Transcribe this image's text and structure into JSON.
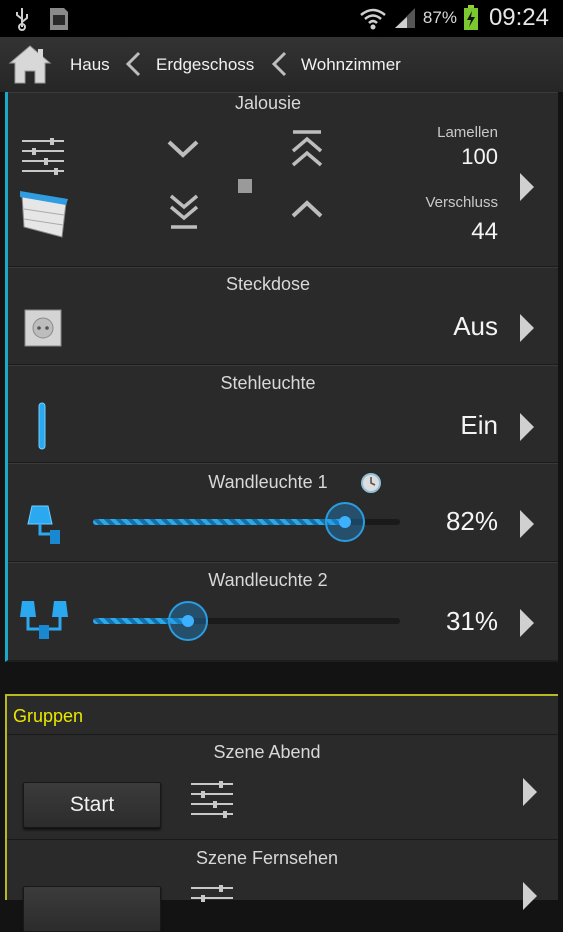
{
  "status": {
    "battery_pct": "87%",
    "time": "09:24"
  },
  "breadcrumb": {
    "items": [
      "Haus",
      "Erdgeschoss",
      "Wohnzimmer"
    ]
  },
  "devices": {
    "jalousie": {
      "title": "Jalousie",
      "lamellen_label": "Lamellen",
      "lamellen_value": "100",
      "verschluss_label": "Verschluss",
      "verschluss_value": "44"
    },
    "steckdose": {
      "title": "Steckdose",
      "value": "Aus"
    },
    "stehleuchte": {
      "title": "Stehleuchte",
      "value": "Ein"
    },
    "wandleuchte1": {
      "title": "Wandleuchte 1",
      "value": "82%",
      "level": 82
    },
    "wandleuchte2": {
      "title": "Wandleuchte 2",
      "value": "31%",
      "level": 31
    }
  },
  "groups": {
    "title": "Gruppen",
    "scenes": [
      {
        "title": "Szene Abend",
        "button": "Start"
      },
      {
        "title": "Szene Fernsehen",
        "button": ""
      }
    ]
  },
  "colors": {
    "accent_blue": "#1aa8c8",
    "group_yellow": "#e8e800",
    "slider_blue": "#2aa8e8"
  }
}
